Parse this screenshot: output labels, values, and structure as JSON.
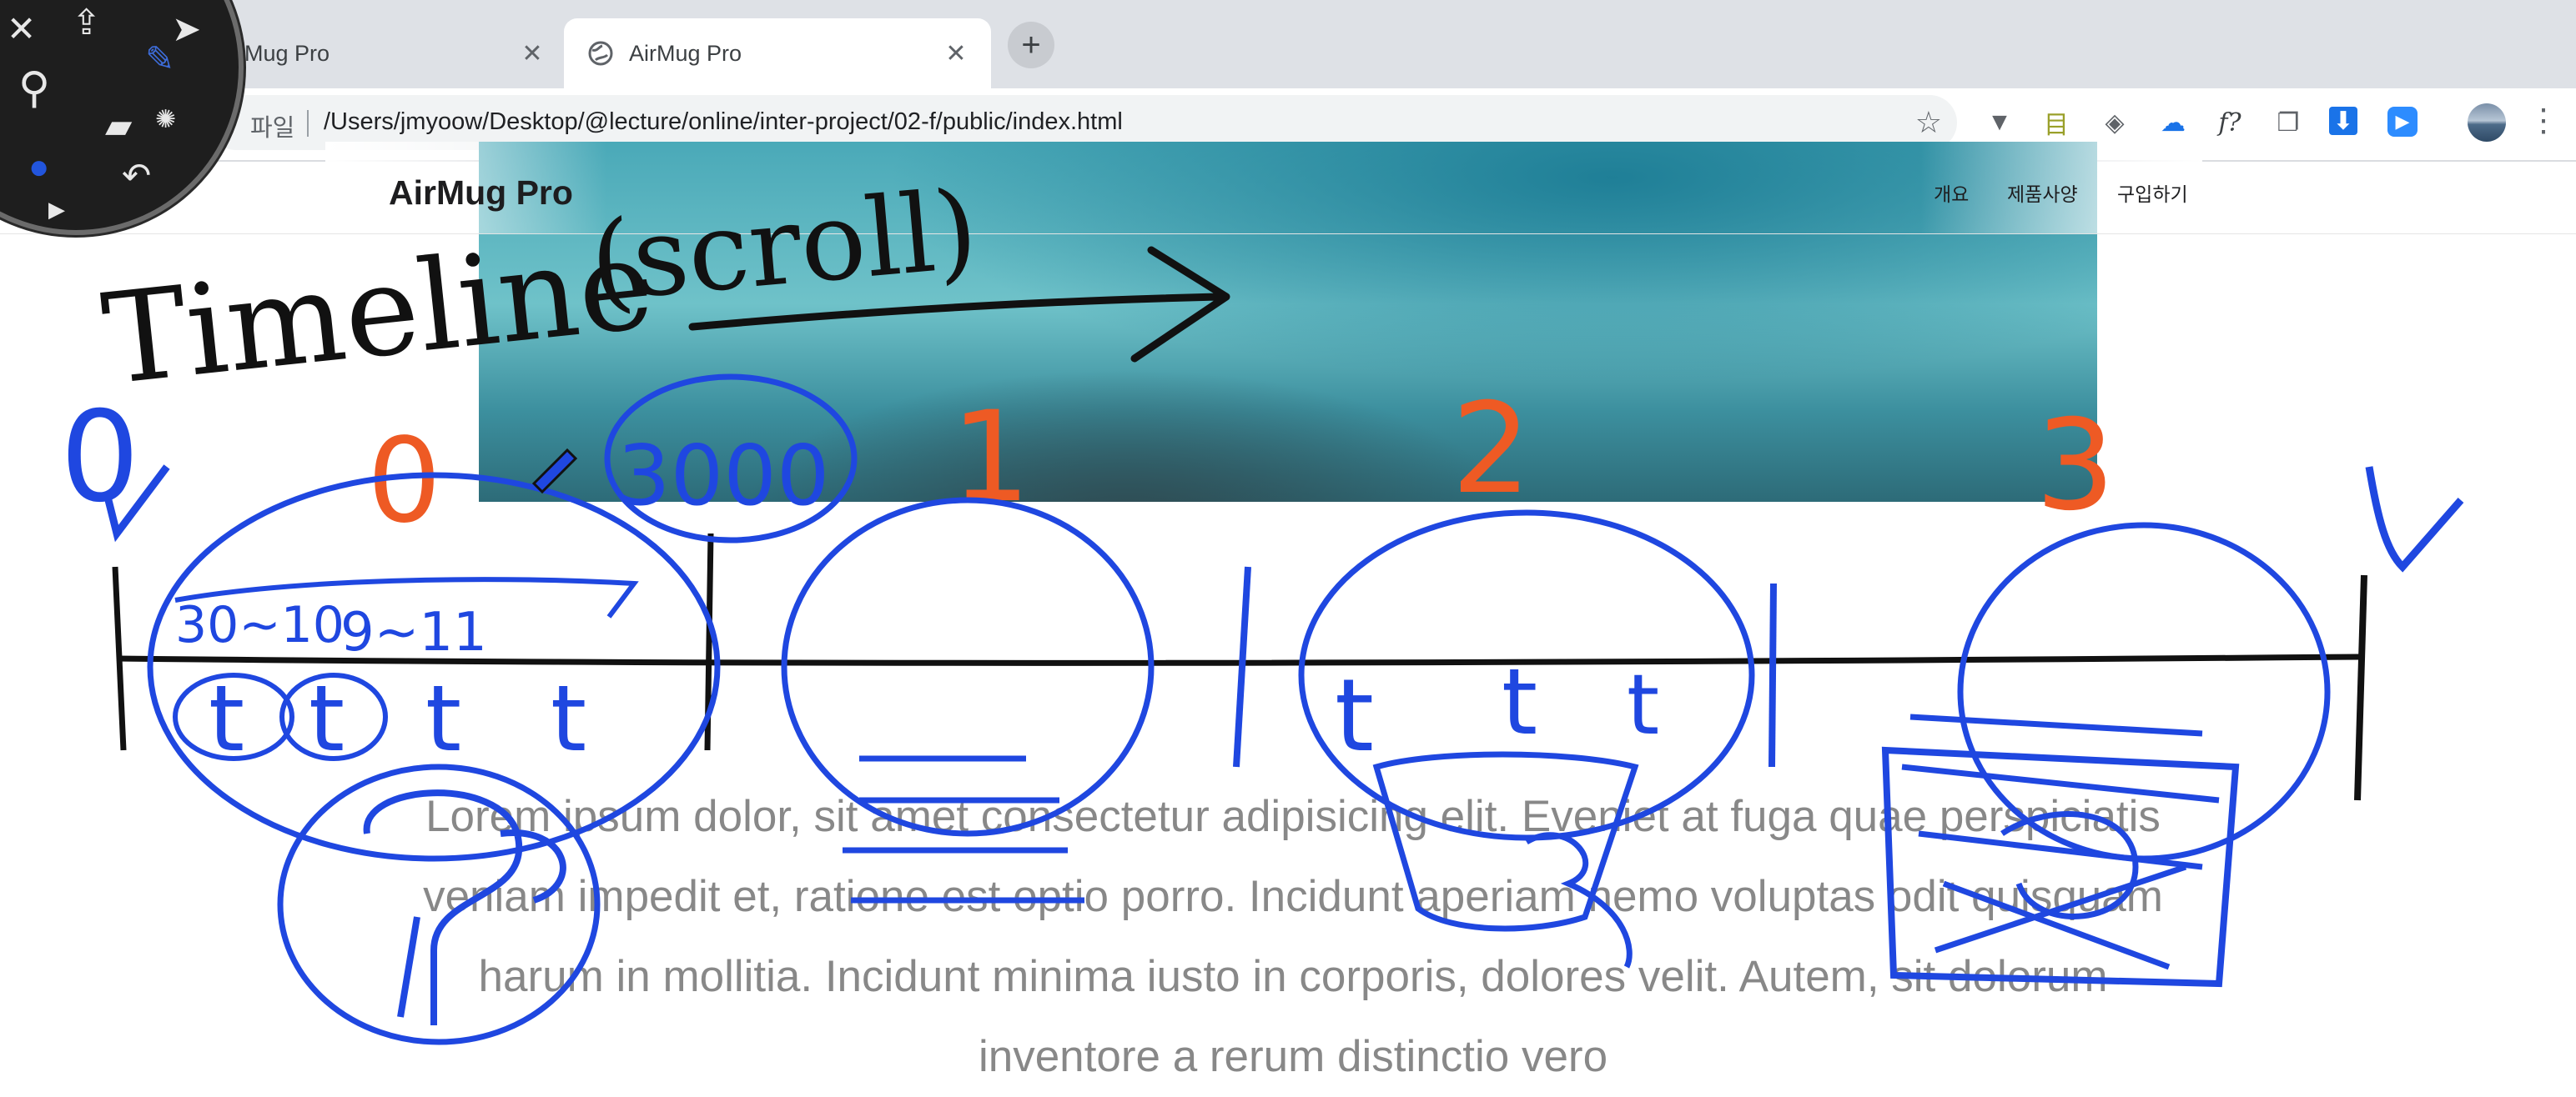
{
  "browser": {
    "tabs": [
      {
        "title": "AirMug Pro",
        "active": false
      },
      {
        "title": "AirMug Pro",
        "active": true
      }
    ],
    "new_tab_symbol": "+",
    "close_symbol": "✕",
    "address_scheme": "파일",
    "address_url": "/Users/jmyoow/Desktop/@lecture/online/inter-project/02-f/public/index.html",
    "extensions": [
      "vuejs-devtools-icon",
      "bookmark-tag-icon",
      "price-tag-icon",
      "cloud-icon",
      "font-finder-icon",
      "copy-pages-icon",
      "download-icon",
      "zoom-video-icon"
    ],
    "font_ext_label": "f?"
  },
  "page": {
    "brand": "AirMug Pro",
    "nav": [
      "개요",
      "제품사양",
      "구입하기"
    ],
    "description": "Lorem ipsum dolor, sit amet consectetur adipisicing elit. Eveniet at fuga quae perspiciatis veniam impedit et, ratione est optio porro. Incidunt aperiam nemo voluptas odit quisquam harum in mollitia. Incidunt minima iusto in corporis, dolores velit. Autem, sit dolorum inventore a rerum distinctio vero"
  },
  "annotation": {
    "heading": "Timeline",
    "heading_paren": "(scroll)",
    "start_marker": "0",
    "section_numbers": [
      "0",
      "1",
      "2",
      "3"
    ],
    "scroll_value": "3000",
    "range_labels": [
      "30~10",
      "9~11"
    ],
    "t_marks": [
      "t",
      "t",
      "t",
      "t",
      "t",
      "t",
      "t"
    ],
    "colors": {
      "ink_black": "#111111",
      "ink_blue": "#1f47e0",
      "ink_orange": "#ee5a24"
    }
  },
  "colors": {
    "chrome_bg": "#dee1e6",
    "omnibox_bg": "#f1f3f4",
    "nav_text": "#1d1d1f",
    "body_text": "#888888"
  }
}
